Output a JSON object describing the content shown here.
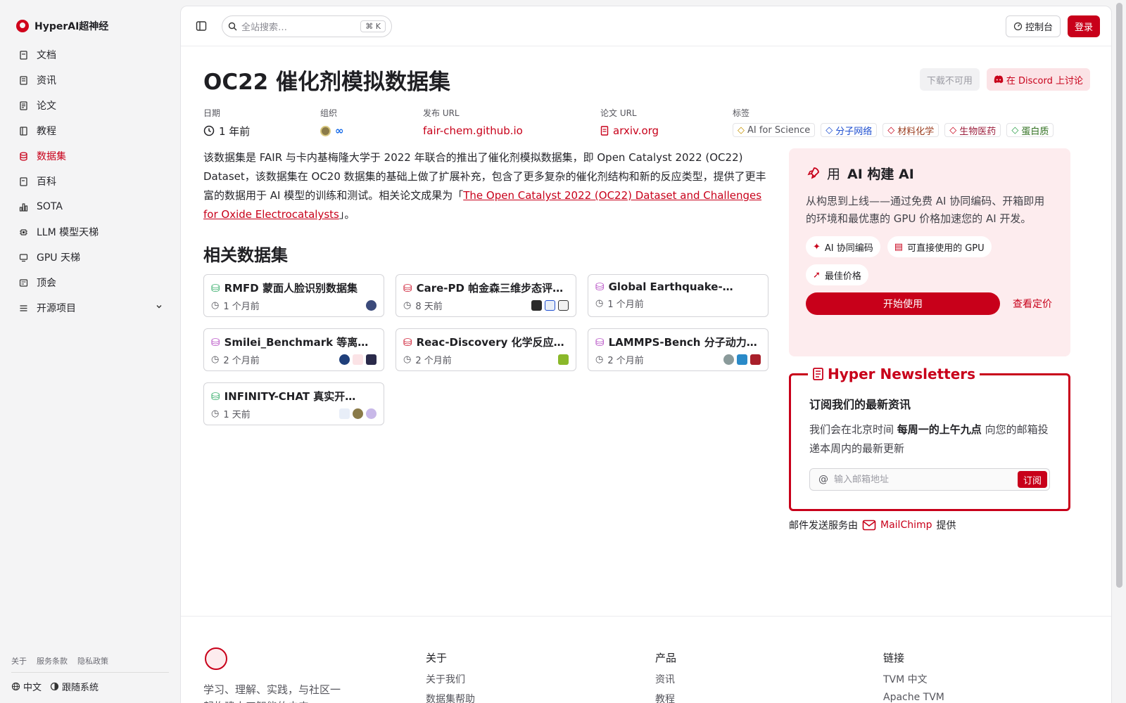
{
  "brand": {
    "name": "HyperAI超神经",
    "accent": "#c8001a"
  },
  "sidebar": {
    "items": [
      {
        "label": "文档",
        "icon": "doc-icon"
      },
      {
        "label": "资讯",
        "icon": "news-icon"
      },
      {
        "label": "论文",
        "icon": "paper-icon"
      },
      {
        "label": "教程",
        "icon": "tutorial-icon"
      },
      {
        "label": "数据集",
        "icon": "database-icon",
        "active": true
      },
      {
        "label": "百科",
        "icon": "wiki-icon"
      },
      {
        "label": "SOTA",
        "icon": "chart-icon"
      },
      {
        "label": "LLM 模型天梯",
        "icon": "chip-icon"
      },
      {
        "label": "GPU 天梯",
        "icon": "monitor-icon"
      },
      {
        "label": "顶会",
        "icon": "conference-icon"
      },
      {
        "label": "开源项目",
        "icon": "list-icon"
      }
    ],
    "footer_links": [
      "关于",
      "服务条款",
      "隐私政策"
    ],
    "language": "中文",
    "theme": "跟随系统"
  },
  "topbar": {
    "search_placeholder": "全站搜索…",
    "shortcut": "K",
    "console_label": "控制台",
    "login_label": "登录"
  },
  "page": {
    "title": "OC22 催化剂模拟数据集",
    "download_label": "下载不可用",
    "discord_label": "在 Discord 上讨论",
    "meta": {
      "date_label": "日期",
      "date_value": "1 年前",
      "org_label": "组织",
      "release_label": "发布 URL",
      "release_value": "fair-chem.github.io",
      "paper_label": "论文 URL",
      "paper_value": "arxiv.org",
      "tags_label": "标签",
      "tags": [
        "AI for Science",
        "分子网络",
        "材料化学",
        "生物医药",
        "蛋白质"
      ]
    },
    "description_prefix": "该数据集是 FAIR 与卡内基梅隆大学于 2022 年联合的推出了催化剂模拟数据集，即 Open Catalyst 2022 (OC22) Dataset，该数据集在 OC20 数据集的基础上做了扩展补充，包含了更多复杂的催化剂结构和新的反应类型，提供了更丰富的数据用于 AI 模型的训练和测试。相关论文成果为「",
    "description_link": "The Open Catalyst 2022 (OC22) Dataset and Challenges for Oxide Electrocatalysts",
    "description_suffix": "」。",
    "related_title": "相关数据集",
    "related": [
      {
        "title": "RMFD 蒙面人脸识别数据集",
        "time": "1 个月前",
        "icon_color": "#22a55b"
      },
      {
        "title": "Care-PD 帕金森三维步态评…",
        "time": "8 天前",
        "icon_color": "#c8001a"
      },
      {
        "title": "Global Earthquake-…",
        "time": "1 个月前",
        "icon_color": "#b040c0"
      },
      {
        "title": "Smilei_Benchmark 等离…",
        "time": "2 个月前",
        "icon_color": "#b040c0"
      },
      {
        "title": "Reac-Discovery 化学反应…",
        "time": "2 个月前",
        "icon_color": "#c8001a"
      },
      {
        "title": "LAMMPS-Bench 分子动力…",
        "time": "2 个月前",
        "icon_color": "#b040c0"
      },
      {
        "title": "INFINITY-CHAT 真实开…",
        "time": "1 天前",
        "icon_color": "#22a55b"
      }
    ]
  },
  "promo": {
    "title_prefix": "用",
    "title_bold": "AI 构建 AI",
    "text": "从构思到上线——通过免费 AI 协同编码、开箱即用的环境和最优惠的 GPU 价格加速您的 AI 开发。",
    "chips": [
      "AI 协同编码",
      "可直接使用的 GPU",
      "最佳价格"
    ],
    "start_label": "开始使用",
    "pricing_label": "查看定价"
  },
  "newsletter": {
    "title": "Hyper Newsletters",
    "subtitle": "订阅我们的最新资讯",
    "text_prefix": "我们会在北京时间 ",
    "text_bold": "每周一的上午九点",
    "text_suffix": " 向您的邮箱投递本周内的最新更新",
    "placeholder": "输入邮箱地址",
    "subscribe_label": "订阅",
    "provider_prefix": "邮件发送服务由",
    "provider_name": "MailChimp",
    "provider_suffix": "提供"
  },
  "footer": {
    "tagline": "学习、理解、实践，与社区一起构建人工智能的未来",
    "columns": [
      {
        "head": "关于",
        "links": [
          "关于我们",
          "数据集帮助"
        ]
      },
      {
        "head": "产品",
        "links": [
          "资讯",
          "教程"
        ]
      },
      {
        "head": "链接",
        "links": [
          "TVM 中文",
          "Apache TVM"
        ]
      }
    ]
  }
}
